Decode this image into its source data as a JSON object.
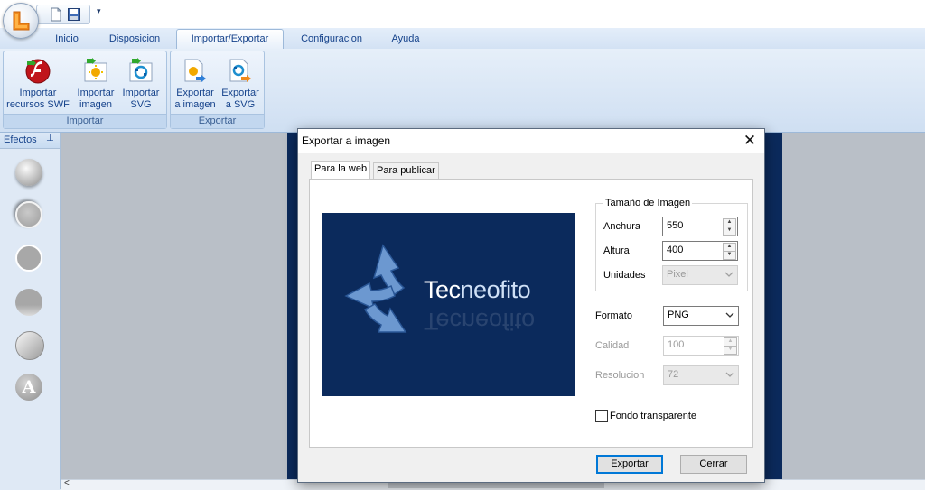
{
  "app": {
    "orb_icon": "app-logo-icon",
    "quick_access": [
      "new-document-icon",
      "save-icon",
      "customize-dropdown-icon"
    ],
    "qat_dropdown_glyph": "▾"
  },
  "ribbon": {
    "tabs": [
      {
        "label": "Inicio",
        "active": false
      },
      {
        "label": "Disposicion",
        "active": false
      },
      {
        "label": "Importar/Exportar",
        "active": true
      },
      {
        "label": "Configuracion",
        "active": false
      },
      {
        "label": "Ayuda",
        "active": false
      }
    ],
    "groups": [
      {
        "label": "Importar",
        "buttons": [
          {
            "label": "Importar\nrecursos SWF",
            "icon": "flash-import-icon"
          },
          {
            "label": "Importar\nimagen",
            "icon": "image-import-icon"
          },
          {
            "label": "Importar\nSVG",
            "icon": "svg-import-icon"
          }
        ]
      },
      {
        "label": "Exportar",
        "buttons": [
          {
            "label": "Exportar\na imagen",
            "icon": "image-export-icon"
          },
          {
            "label": "Exportar\na SVG",
            "icon": "svg-export-icon"
          }
        ]
      }
    ]
  },
  "effects_panel": {
    "title": "Efectos",
    "pin_glyph": "⊥",
    "items": [
      "raised-circle-effect",
      "shadow-circle-effect",
      "outline-circle-effect",
      "reflection-circle-effect",
      "gradient-circle-effect",
      "text-effect"
    ],
    "text_effect_letter": "A"
  },
  "scrollbar": {
    "left_arrow": "<"
  },
  "dialog": {
    "title": "Exportar a imagen",
    "close_glyph": "✕",
    "tabs": [
      {
        "label": "Para la web",
        "active": true
      },
      {
        "label": "Para publicar",
        "active": false
      }
    ],
    "preview": {
      "logo_text_bold": "Tec",
      "logo_text_light": "neofito",
      "background": "#0b2a5c",
      "icon": "recycle-arrows-icon"
    },
    "size_group": {
      "legend": "Tamaño de Imagen",
      "width_label": "Anchura",
      "width_value": "550",
      "height_label": "Altura",
      "height_value": "400",
      "units_label": "Unidades",
      "units_value": "Pixel"
    },
    "format": {
      "label": "Formato",
      "value": "PNG"
    },
    "quality": {
      "label": "Calidad",
      "value": "100",
      "disabled": true
    },
    "resolution": {
      "label": "Resolucion",
      "value": "72",
      "disabled": true
    },
    "transparent_bg": {
      "label": "Fondo transparente",
      "checked": false
    },
    "export_button": "Exportar",
    "close_button": "Cerrar"
  },
  "colors": {
    "ribbon_text": "#15428b",
    "canvas_doc": "#0b2a5c",
    "default_button_border": "#0078d7"
  }
}
